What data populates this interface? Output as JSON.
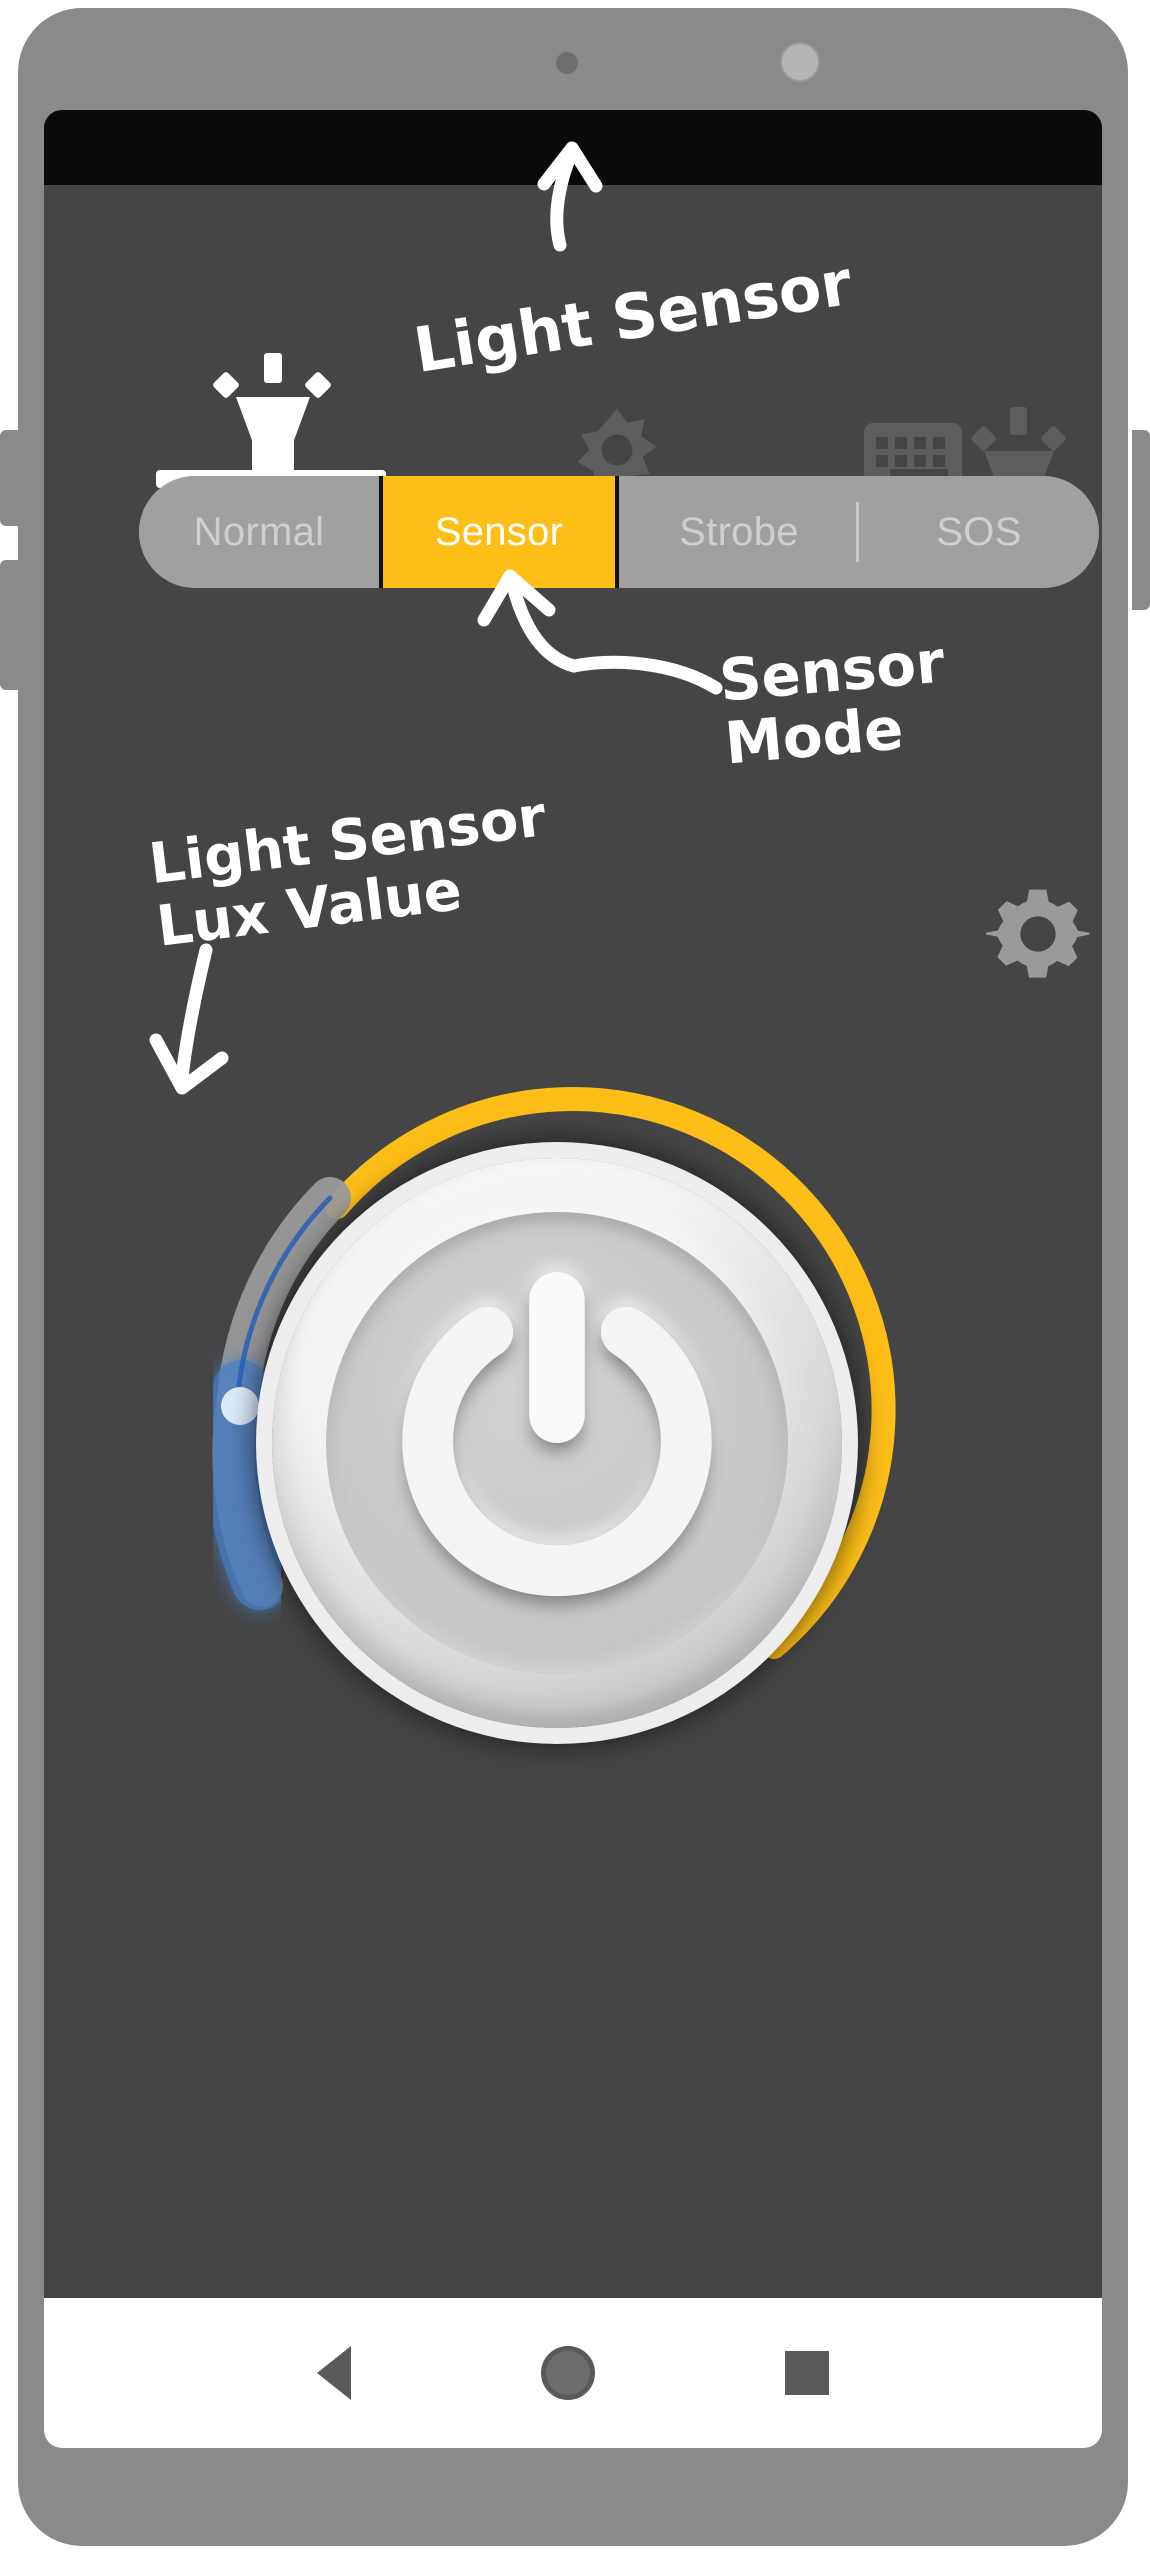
{
  "device": {
    "name": "android-phone-mockup",
    "body_color": "#8a8a8a",
    "screen_bg": "#454545",
    "statusbar_color": "#0a0a0a"
  },
  "toolbar": {
    "torch_tab_icon": "torch-icon",
    "brightness_icon": "brightness-icon",
    "keyboard_icon": "keyboard-icon",
    "torch_icon": "torch-icon",
    "icon_color": "#5d5d5d",
    "active_color": "#ffffff"
  },
  "modes": {
    "items": [
      {
        "label": "Normal",
        "active": false
      },
      {
        "label": "Sensor",
        "active": true
      },
      {
        "label": "Strobe",
        "active": false
      },
      {
        "label": "SOS",
        "active": false
      }
    ],
    "active_bg": "#FDBE18",
    "inactive_bg": "#a0a0a0",
    "inactive_text": "#cfcfcf",
    "active_text": "#ffffff"
  },
  "settings": {
    "gear_icon": "gear-icon",
    "color": "#9a9a9a"
  },
  "dial": {
    "power_icon": "power-icon",
    "brightness_arc_color": "#FDBE18",
    "lux_arc_color": "#4a7fc8",
    "lux_track_color": "#9a9a9a",
    "lux_handle_color": "#dceafa",
    "brightness_arc_start_deg": -133,
    "brightness_arc_end_deg": 133,
    "lux_arc_start_deg": -133,
    "lux_arc_end_deg": -193
  },
  "annotations": {
    "light_sensor": "Light Sensor",
    "sensor_mode": "Sensor\nMode",
    "lux_value": "Light Sensor\n  Lux Value",
    "ink_color": "#ffffff"
  },
  "navbar": {
    "back": "back-icon",
    "home": "home-icon",
    "recents": "recents-icon",
    "bg": "#ffffff",
    "icon_color": "#5a5a5a"
  }
}
